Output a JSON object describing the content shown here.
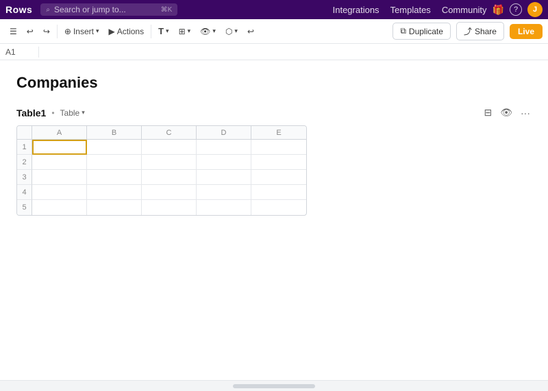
{
  "topbar": {
    "logo": "Rows",
    "search_placeholder": "Search or jump to...",
    "search_shortcut": "⌘K",
    "nav_links": [
      {
        "label": "Integrations",
        "id": "integrations"
      },
      {
        "label": "Templates",
        "id": "templates"
      },
      {
        "label": "Community",
        "id": "community"
      }
    ],
    "gift_icon": "🎁",
    "help_icon": "?",
    "avatar_letter": "J"
  },
  "toolbar": {
    "toggle_label": "",
    "undo_label": "↩",
    "redo_label": "↪",
    "insert_label": "Insert",
    "actions_label": "Actions",
    "text_label": "T",
    "grid_label": "",
    "eye_label": "",
    "chart_label": "",
    "undo_redo": true,
    "duplicate_label": "Duplicate",
    "share_label": "Share",
    "live_label": "Live"
  },
  "cellref": {
    "ref": "A1"
  },
  "content": {
    "page_title": "Companies",
    "table_name": "Table1",
    "table_type": "Table",
    "columns": [
      "A",
      "B",
      "C",
      "D",
      "E"
    ],
    "rows": [
      1,
      2,
      3,
      4,
      5
    ],
    "selected_cell": "A1"
  }
}
